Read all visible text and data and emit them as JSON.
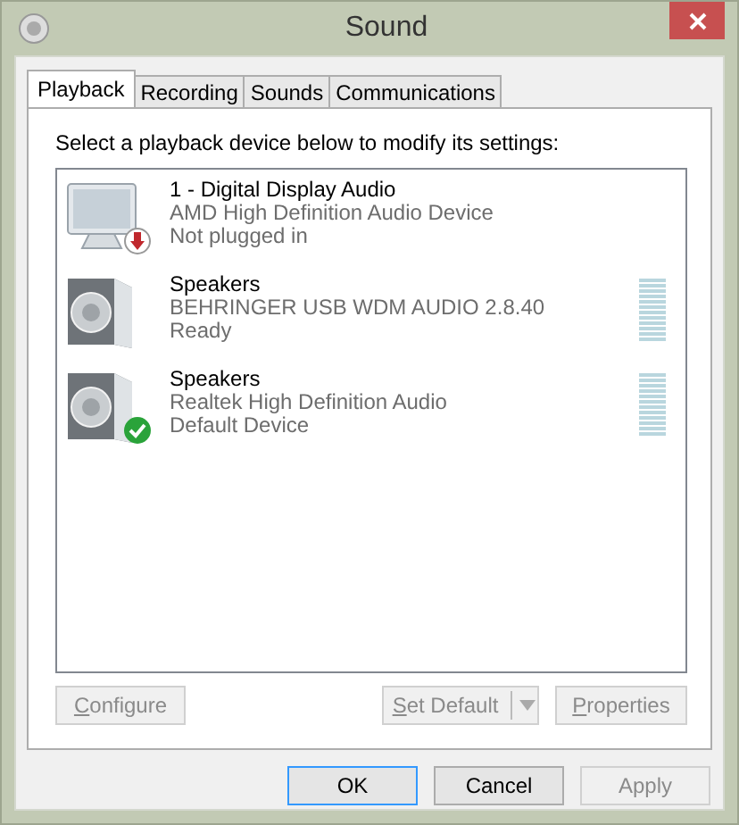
{
  "window": {
    "title": "Sound"
  },
  "tabs": [
    {
      "label": "Playback",
      "selected": true
    },
    {
      "label": "Recording",
      "selected": false
    },
    {
      "label": "Sounds",
      "selected": false
    },
    {
      "label": "Communications",
      "selected": false
    }
  ],
  "instruction": "Select a playback device below to modify its settings:",
  "devices": [
    {
      "kind": "monitor",
      "name": "1 - Digital Display Audio",
      "driver": "AMD High Definition Audio Device",
      "status": "Not plugged in",
      "unplugged": true,
      "is_default": false
    },
    {
      "kind": "speaker",
      "name": "Speakers",
      "driver": "BEHRINGER USB WDM AUDIO 2.8.40",
      "status": "Ready",
      "unplugged": false,
      "is_default": false,
      "meter": {
        "level": 0
      }
    },
    {
      "kind": "speaker",
      "name": "Speakers",
      "driver": "Realtek High Definition Audio",
      "status": "Default Device",
      "unplugged": false,
      "is_default": true,
      "meter": {
        "level": 0
      }
    }
  ],
  "device_buttons": [
    {
      "label": "Configure",
      "disabled": true,
      "split": false
    },
    {
      "label": "Set Default",
      "disabled": true,
      "split": true
    },
    {
      "label": "Properties",
      "disabled": true,
      "split": false
    }
  ],
  "dialog_buttons": [
    {
      "label": "OK",
      "disabled": false,
      "default": true
    },
    {
      "label": "Cancel",
      "disabled": false,
      "default": false
    },
    {
      "label": "Apply",
      "disabled": true,
      "default": false
    }
  ]
}
